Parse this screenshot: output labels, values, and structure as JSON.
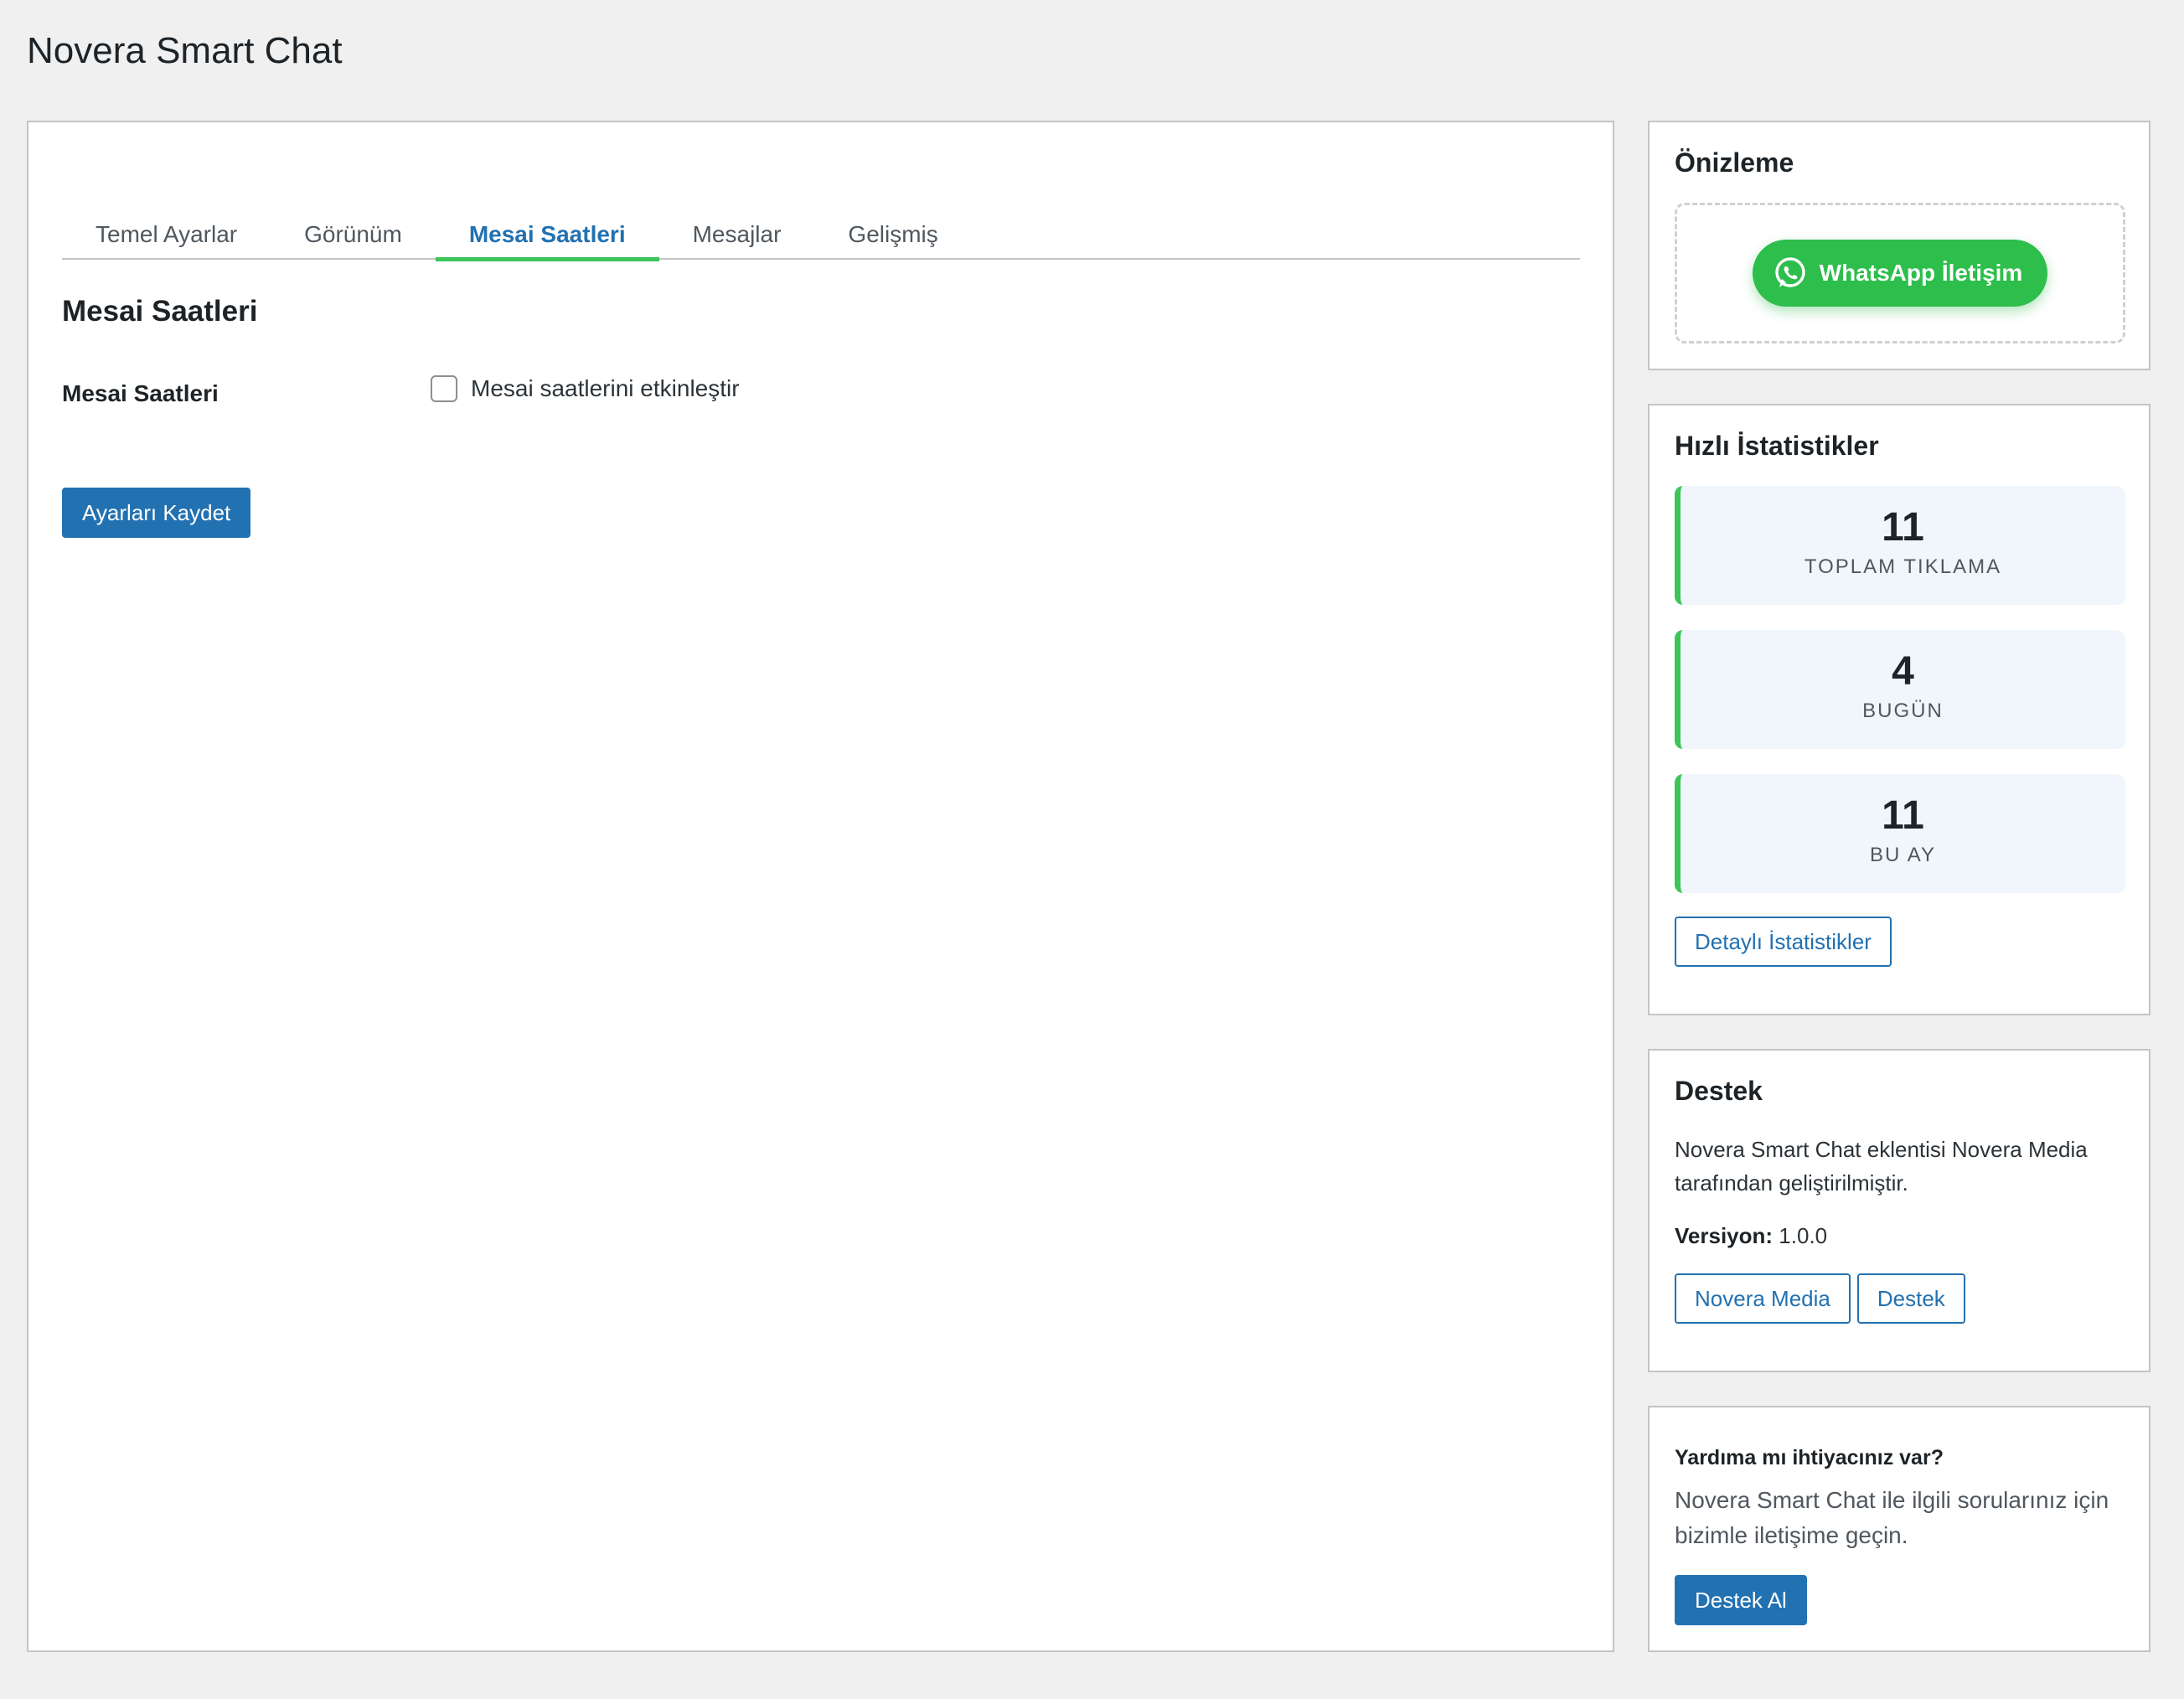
{
  "page": {
    "title": "Novera Smart Chat"
  },
  "tabs": [
    {
      "label": "Temel Ayarlar",
      "active": false
    },
    {
      "label": "Görünüm",
      "active": false
    },
    {
      "label": "Mesai Saatleri",
      "active": true
    },
    {
      "label": "Mesajlar",
      "active": false
    },
    {
      "label": "Gelişmiş",
      "active": false
    }
  ],
  "section": {
    "title": "Mesai Saatleri",
    "field_label": "Mesai Saatleri",
    "checkbox_label": "Mesai saatlerini etkinleştir",
    "checkbox_checked": false,
    "save_button": "Ayarları Kaydet"
  },
  "preview": {
    "title": "Önizleme",
    "button_label": "WhatsApp İletişim",
    "icon": "whatsapp-icon",
    "button_color": "#2dbe4c"
  },
  "stats": {
    "title": "Hızlı İstatistikler",
    "cards": [
      {
        "value": "11",
        "label": "TOPLAM TIKLAMA"
      },
      {
        "value": "4",
        "label": "BUGÜN"
      },
      {
        "value": "11",
        "label": "BU AY"
      }
    ],
    "detail_button": "Detaylı İstatistikler"
  },
  "support": {
    "title": "Destek",
    "text": "Novera Smart Chat eklentisi Novera Media tarafından geliştirilmiştir.",
    "version_label": "Versiyon:",
    "version_value": "1.0.0",
    "links": [
      "Novera Media",
      "Destek"
    ]
  },
  "help": {
    "title": "Yardıma mı ihtiyacınız var?",
    "text": "Novera Smart Chat ile ilgili sorularınız için bizimle iletişime geçin.",
    "button": "Destek Al"
  },
  "colors": {
    "accent": "#2271b1",
    "tab_underline": "#3dc55a",
    "stat_bg": "#f0f6fc"
  }
}
